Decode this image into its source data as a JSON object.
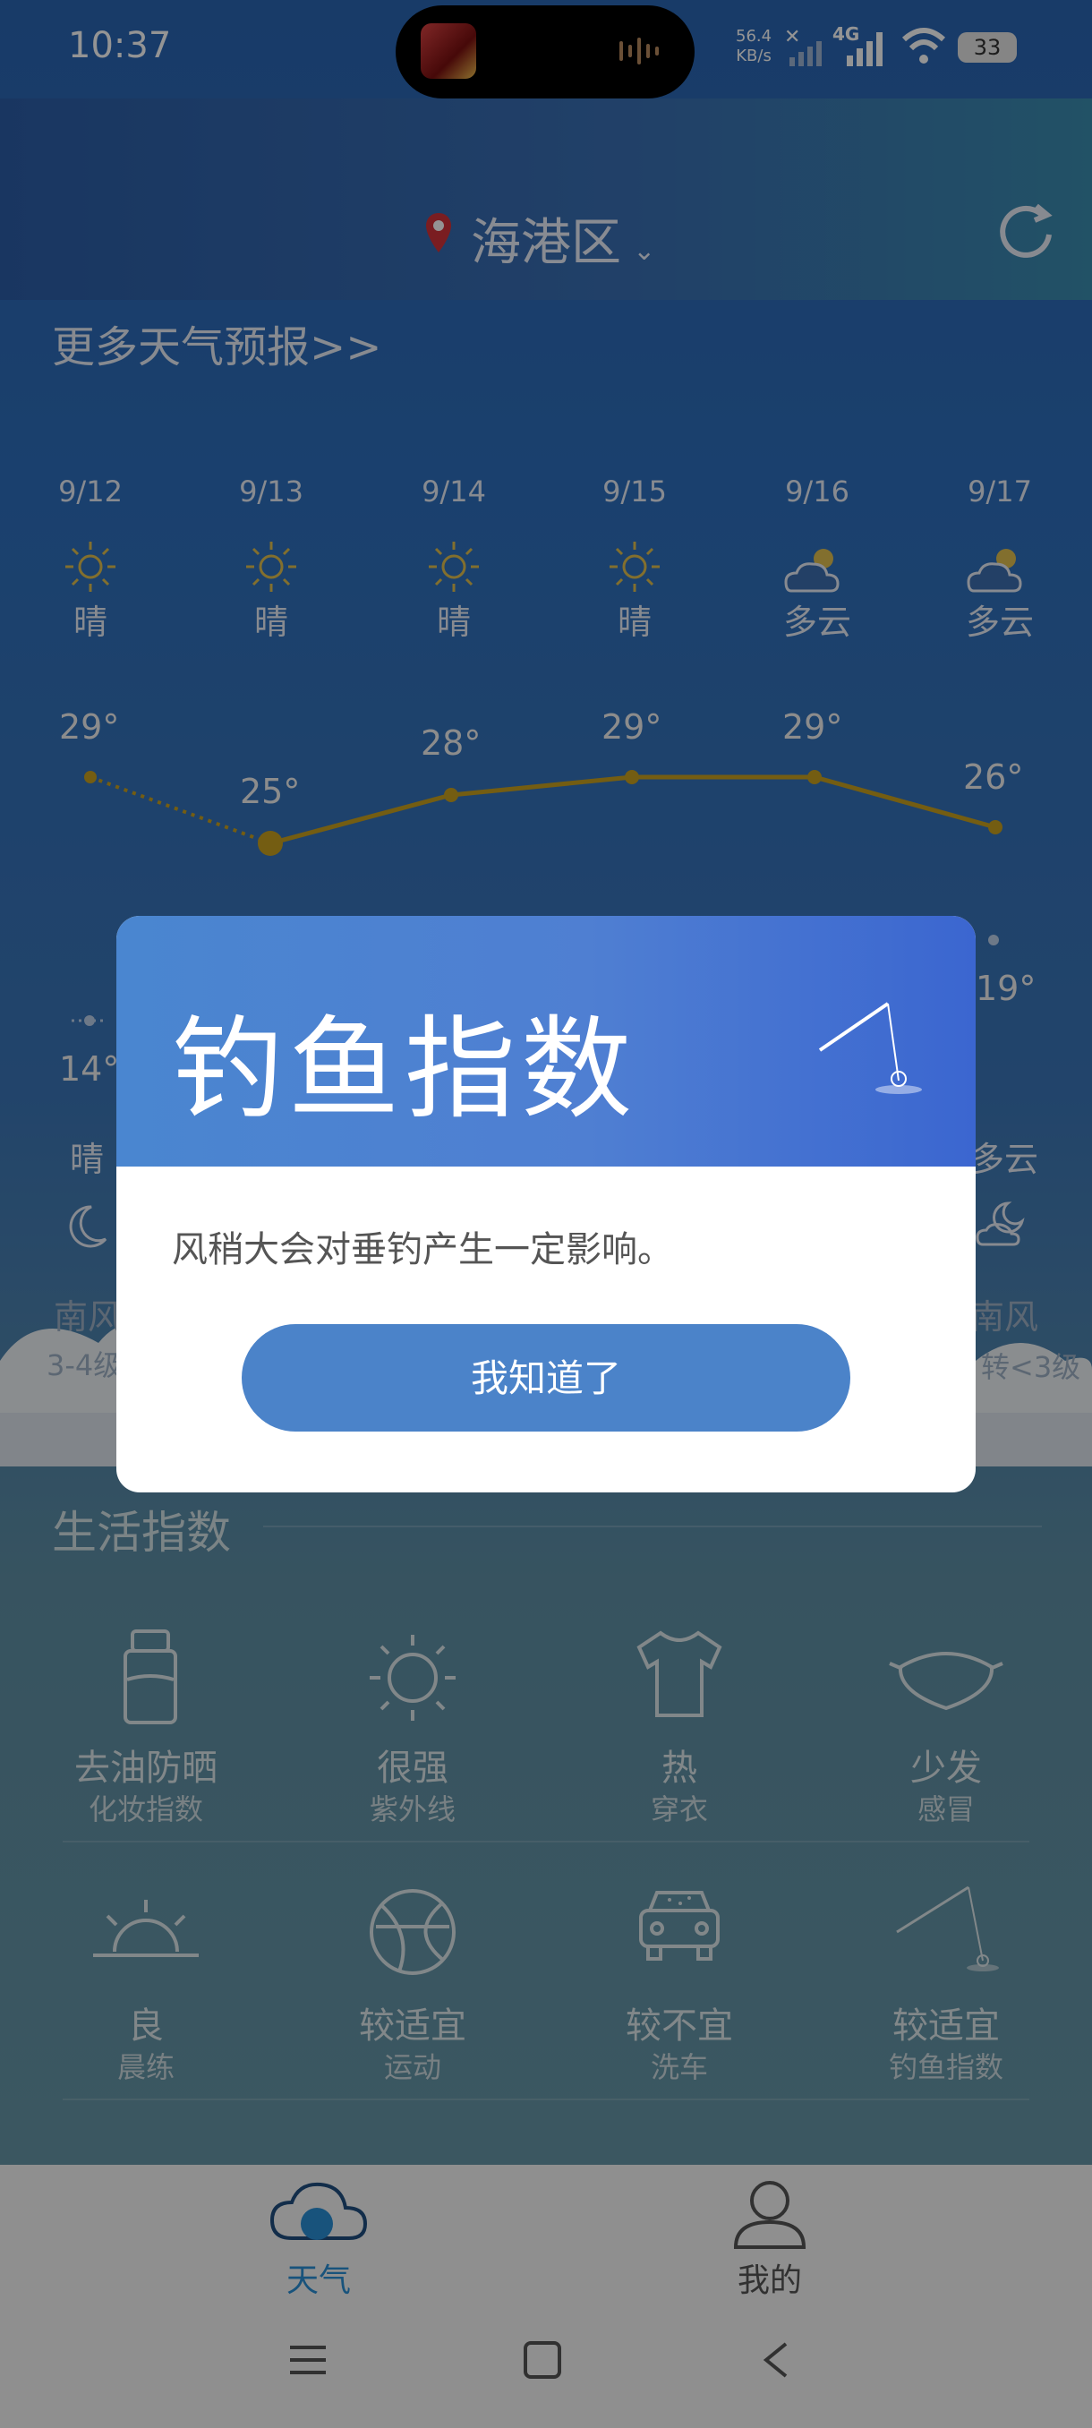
{
  "status_bar": {
    "time": "10:37",
    "net_speed_value": "56.4",
    "net_speed_unit": "KB/s",
    "network": "4G",
    "battery": "33"
  },
  "header": {
    "city": "海港区",
    "more_forecast": "更多天气预报>>"
  },
  "forecast": [
    {
      "date": "9/12",
      "icon": "sun-icon",
      "desc": "晴",
      "high": "29°"
    },
    {
      "date": "9/13",
      "icon": "sun-icon",
      "desc": "晴",
      "high": "25°"
    },
    {
      "date": "9/14",
      "icon": "sun-icon",
      "desc": "晴",
      "high": "28°"
    },
    {
      "date": "9/15",
      "icon": "sun-icon",
      "desc": "晴",
      "high": "29°"
    },
    {
      "date": "9/16",
      "icon": "partly-cloudy-icon",
      "desc": "多云",
      "high": "29°"
    },
    {
      "date": "9/17",
      "icon": "partly-cloudy-icon",
      "desc": "多云",
      "high": "26°"
    }
  ],
  "forecast_partial": {
    "left_low": "14°",
    "left_night_desc": "晴",
    "left_wind": "南风",
    "left_wind_level": "3-4级",
    "right_low": "19°",
    "right_night_desc": "多云",
    "right_wind": "南风",
    "right_wind_level": "转<3级"
  },
  "life_index": {
    "title": "生活指数",
    "items": [
      {
        "icon": "bottle-icon",
        "value": "去油防晒",
        "label": "化妆指数"
      },
      {
        "icon": "sun-icon",
        "value": "很强",
        "label": "紫外线"
      },
      {
        "icon": "tshirt-icon",
        "value": "热",
        "label": "穿衣"
      },
      {
        "icon": "mask-icon",
        "value": "少发",
        "label": "感冒"
      },
      {
        "icon": "sunrise-icon",
        "value": "良",
        "label": "晨练"
      },
      {
        "icon": "basketball-icon",
        "value": "较适宜",
        "label": "运动"
      },
      {
        "icon": "car-icon",
        "value": "较不宜",
        "label": "洗车"
      },
      {
        "icon": "fishing-icon",
        "value": "较适宜",
        "label": "钓鱼指数"
      }
    ]
  },
  "bottom_nav": {
    "weather": "天气",
    "me": "我的"
  },
  "dialog": {
    "title": "钓鱼指数",
    "message": "风稍大会对垂钓产生一定影响。",
    "ok": "我知道了"
  },
  "colors": {
    "accent": "#4b83c9",
    "temp_line": "#c8a020",
    "active_tab": "#2a8fd6"
  }
}
